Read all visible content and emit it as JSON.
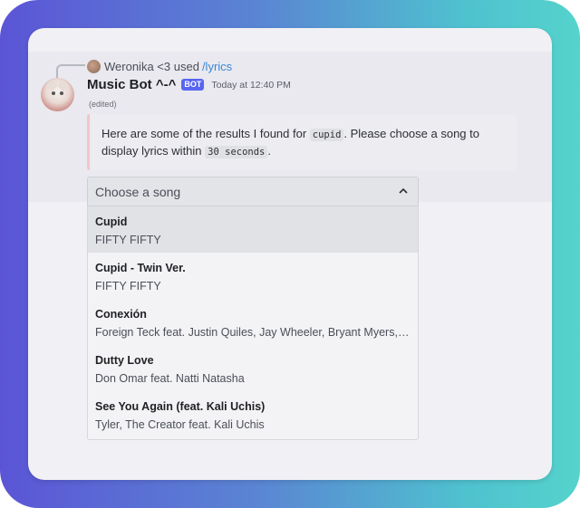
{
  "reply": {
    "user": "Weronika <3",
    "used": "used",
    "command": "/lyrics"
  },
  "message": {
    "author": "Music Bot ^-^",
    "badge": "BOT",
    "timestamp": "Today at 12:40 PM",
    "edited": "(edited)"
  },
  "embed": {
    "text_part1": "Here are some of the results I found for ",
    "query": "cupid",
    "text_part2": ". Please choose a song to display lyrics within ",
    "time_limit": "30 seconds",
    "text_part3": "."
  },
  "select": {
    "placeholder": "Choose a song",
    "options": [
      {
        "title": "Cupid",
        "artist": "FIFTY FIFTY"
      },
      {
        "title": "Cupid - Twin Ver.",
        "artist": "FIFTY FIFTY"
      },
      {
        "title": "Conexión",
        "artist": "Foreign Teck feat. Justin Quiles, Jay Wheeler, Bryant Myers, El..."
      },
      {
        "title": "Dutty Love",
        "artist": "Don Omar feat. Natti Natasha"
      },
      {
        "title": "See You Again (feat. Kali Uchis)",
        "artist": "Tyler, The Creator feat. Kali Uchis"
      }
    ]
  },
  "colors": {
    "bot_badge": "#5865f2",
    "command_link": "#3b86d8",
    "embed_border": "#f2c6cb"
  },
  "icons": [
    "chevron-up-icon"
  ]
}
